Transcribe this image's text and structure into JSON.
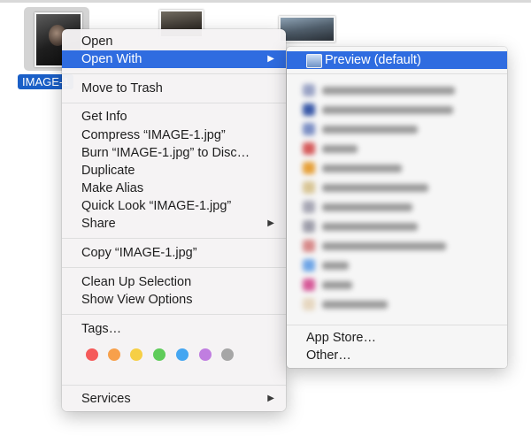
{
  "desktop": {
    "selected_file_label": "IMAGE-1"
  },
  "context_menu": {
    "items": [
      {
        "label": "Open"
      },
      {
        "label": "Open With"
      },
      {
        "label": "Move to Trash"
      },
      {
        "label": "Get Info"
      },
      {
        "label": "Compress “IMAGE-1.jpg”"
      },
      {
        "label": "Burn “IMAGE-1.jpg” to Disc…"
      },
      {
        "label": "Duplicate"
      },
      {
        "label": "Make Alias"
      },
      {
        "label": "Quick Look “IMAGE-1.jpg”"
      },
      {
        "label": "Share"
      },
      {
        "label": "Copy “IMAGE-1.jpg”"
      },
      {
        "label": "Clean Up Selection"
      },
      {
        "label": "Show View Options"
      },
      {
        "label": "Tags…"
      },
      {
        "label": "Services"
      }
    ],
    "submenu_arrow": "▶",
    "tag_colors": [
      "#f55a5a",
      "#f7a04b",
      "#f6cf45",
      "#5fcc5a",
      "#45a6f1",
      "#c07ee0",
      "#a6a6a6"
    ]
  },
  "open_with_submenu": {
    "default_app": "Preview (default)",
    "other_items": [
      "App Store…",
      "Other…"
    ],
    "blurred_app_icon_colors": [
      "#9aa3c5",
      "#3b5aa8",
      "#7c8fc4",
      "#d55b5b",
      "#e6a03a",
      "#d8c596",
      "#a7a7b4",
      "#9e9eaa",
      "#d78a8a",
      "#6fa5e6",
      "#d65a98",
      "#e6d7c0"
    ]
  },
  "accent_color": "#2f6ce0",
  "selection_color": "#1a5fc7"
}
